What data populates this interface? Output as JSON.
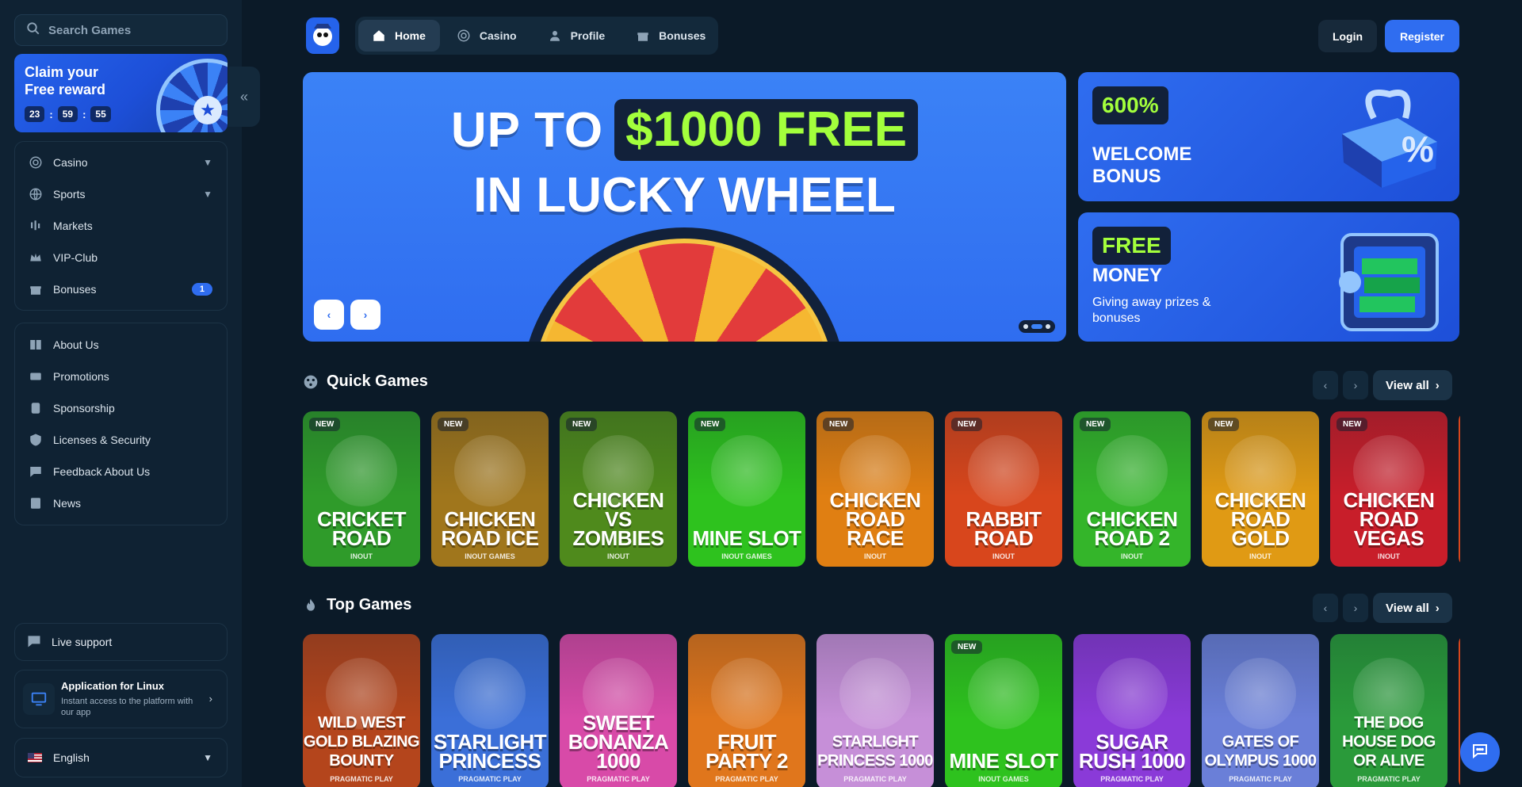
{
  "search": {
    "placeholder": "Search Games"
  },
  "reward": {
    "title": "Claim your Free reward",
    "timer": {
      "hours": "23",
      "minutes": "59",
      "seconds": "55"
    }
  },
  "sidebar": {
    "main_items": [
      {
        "label": "Casino",
        "icon": "casino-chip-icon",
        "expandable": true
      },
      {
        "label": "Sports",
        "icon": "globe-ball-icon",
        "expandable": true
      },
      {
        "label": "Markets",
        "icon": "candlestick-icon"
      },
      {
        "label": "VIP-Club",
        "icon": "crown-icon"
      },
      {
        "label": "Bonuses",
        "icon": "gift-icon",
        "badge": "1"
      }
    ],
    "info_items": [
      {
        "label": "About Us",
        "icon": "book-icon"
      },
      {
        "label": "Promotions",
        "icon": "ticket-icon"
      },
      {
        "label": "Sponsorship",
        "icon": "handshake-icon"
      },
      {
        "label": "Licenses & Security",
        "icon": "shield-icon"
      },
      {
        "label": "Feedback About Us",
        "icon": "feedback-icon"
      },
      {
        "label": "News",
        "icon": "newspaper-icon"
      }
    ],
    "live_support": "Live support",
    "app": {
      "title": "Application for Linux",
      "subtitle": "Instant access to the platform with our app"
    },
    "language": "English"
  },
  "header": {
    "tabs": [
      {
        "label": "Home",
        "icon": "home-icon",
        "active": true
      },
      {
        "label": "Casino",
        "icon": "casino-chip-icon"
      },
      {
        "label": "Profile",
        "icon": "user-icon"
      },
      {
        "label": "Bonuses",
        "icon": "gift-icon"
      }
    ],
    "login": "Login",
    "register": "Register"
  },
  "hero": {
    "line1_prefix": "UP TO",
    "line1_highlight": "$1000 FREE",
    "line2": "IN LUCKY WHEEL",
    "active_slide": 2,
    "slide_count": 3
  },
  "promos": [
    {
      "tag": "600%",
      "title": "WELCOME BONUS"
    },
    {
      "tag": "FREE",
      "title": "MONEY",
      "subtitle": "Giving away prizes & bonuses"
    }
  ],
  "quick_games": {
    "title": "Quick Games",
    "view_all": "View all",
    "games": [
      {
        "name": "Cricket Road",
        "provider": "INOUT",
        "new": "NEW",
        "color": "#2f9b2a"
      },
      {
        "name": "Chicken Road Ice",
        "provider": "INOUT GAMES",
        "new": "NEW",
        "color": "#a0761c"
      },
      {
        "name": "Chicken vs Zombies",
        "provider": "INOUT",
        "new": "NEW",
        "color": "#4f8a1c"
      },
      {
        "name": "Mine Slot",
        "provider": "INOUT GAMES",
        "new": "NEW",
        "color": "#2ec21e"
      },
      {
        "name": "Chicken Road Race",
        "provider": "INOUT",
        "new": "NEW",
        "color": "#e07f12"
      },
      {
        "name": "Rabbit Road",
        "provider": "INOUT",
        "new": "NEW",
        "color": "#d8461c"
      },
      {
        "name": "Chicken Road 2",
        "provider": "INOUT",
        "new": "NEW",
        "color": "#34b52a"
      },
      {
        "name": "Chicken Road Gold",
        "provider": "INOUT",
        "new": "NEW",
        "color": "#e09a14"
      },
      {
        "name": "Chicken Road Vegas",
        "provider": "INOUT",
        "new": "NEW",
        "color": "#c81e2a"
      }
    ]
  },
  "top_games": {
    "title": "Top Games",
    "view_all": "View all",
    "games": [
      {
        "name": "Wild West Gold Blazing Bounty",
        "provider": "PRAGMATIC PLAY",
        "color": "#b4451c"
      },
      {
        "name": "Starlight Princess",
        "provider": "PRAGMATIC PLAY",
        "color": "#3b6fd8"
      },
      {
        "name": "Sweet Bonanza 1000",
        "provider": "PRAGMATIC PLAY",
        "color": "#d84aa8"
      },
      {
        "name": "Fruit Party 2",
        "provider": "PRAGMATIC PLAY",
        "color": "#e0761c"
      },
      {
        "name": "Starlight Princess 1000",
        "provider": "PRAGMATIC PLAY",
        "color": "#c68fd8"
      },
      {
        "name": "Mine Slot",
        "provider": "INOUT GAMES",
        "new": "NEW",
        "color": "#2ec21e"
      },
      {
        "name": "Sugar Rush 1000",
        "provider": "PRAGMATIC PLAY",
        "color": "#8a3ad8"
      },
      {
        "name": "Gates of Olympus 1000",
        "provider": "PRAGMATIC PLAY",
        "color": "#6a7fd8"
      },
      {
        "name": "The Dog House Dog or Alive",
        "provider": "PRAGMATIC PLAY",
        "color": "#2a9a3a"
      }
    ]
  }
}
